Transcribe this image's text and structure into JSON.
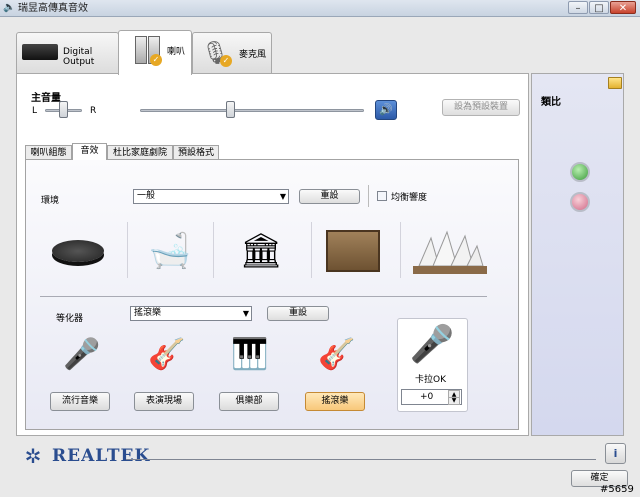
{
  "window": {
    "title": "瑞昱高傳真音效"
  },
  "device_tabs": [
    {
      "label": "Digital Output"
    },
    {
      "label": "喇叭"
    },
    {
      "label": "麥克風"
    }
  ],
  "master_volume": {
    "title": "主音量",
    "left": "L",
    "right": "R",
    "preset_button": "設為預設裝置"
  },
  "sub_tabs": [
    "喇叭組態",
    "音效",
    "杜比家庭劇院",
    "預設格式"
  ],
  "environment": {
    "label": "環境",
    "selected": "一般",
    "reset": "重設",
    "loudness": "均衡響度"
  },
  "equalizer": {
    "label": "等化器",
    "selected": "搖滾樂",
    "reset": "重設",
    "presets": [
      "流行音樂",
      "表演現場",
      "俱樂部",
      "搖滾樂"
    ],
    "selected_preset": "搖滾樂"
  },
  "karaoke": {
    "label": "卡拉OK",
    "value": "+0"
  },
  "right_panel": {
    "title": "類比"
  },
  "footer": {
    "brand": "REALTEK",
    "ok": "確定",
    "watermark": "#5659"
  }
}
